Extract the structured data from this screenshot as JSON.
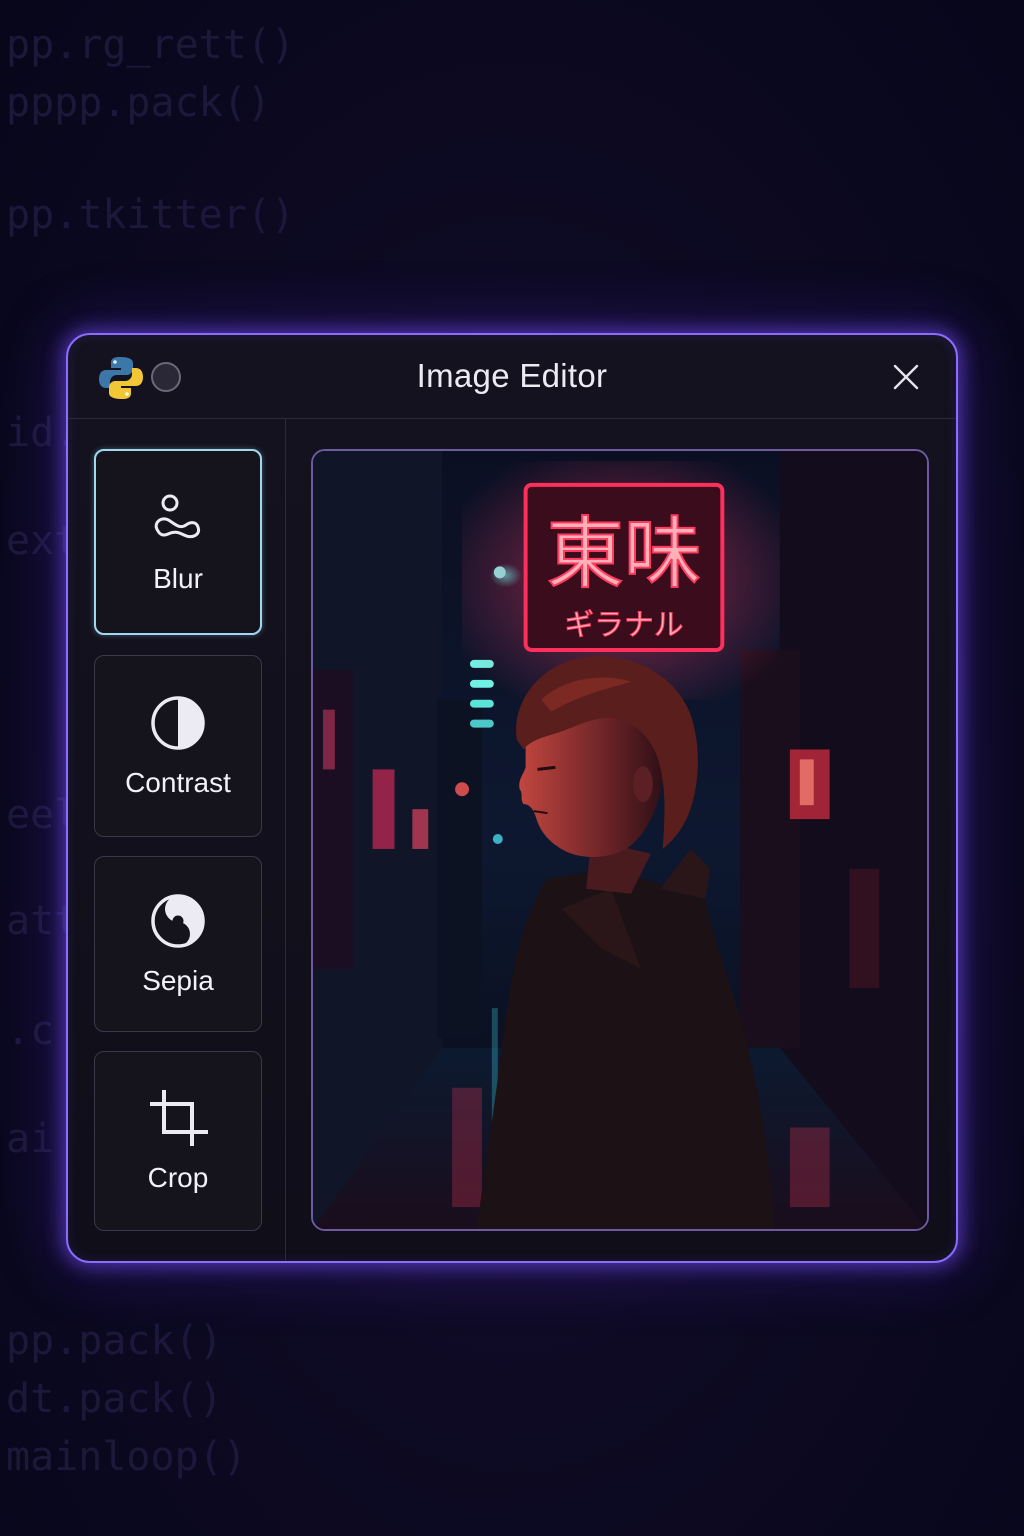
{
  "background_code": [
    "pp.rg_rett()",
    "pppp.pack()",
    "pp.tkitter()",
    "id.",
    "ext",
    "eel",
    "att",
    ".c",
    "ai",
    "pp.pack()",
    "dt.pack()",
    "mainloop()"
  ],
  "window": {
    "title": "Image Editor",
    "accent": "#8a6cff"
  },
  "tools": [
    {
      "label": "Blur",
      "icon": "blur-icon",
      "active": true
    },
    {
      "label": "Contrast",
      "icon": "contrast-icon",
      "active": false
    },
    {
      "label": "Sepia",
      "icon": "sepia-icon",
      "active": false
    },
    {
      "label": "Crop",
      "icon": "crop-icon",
      "active": false
    }
  ],
  "preview": {
    "sign_main": "東味",
    "sign_sub": "ギラナル"
  }
}
